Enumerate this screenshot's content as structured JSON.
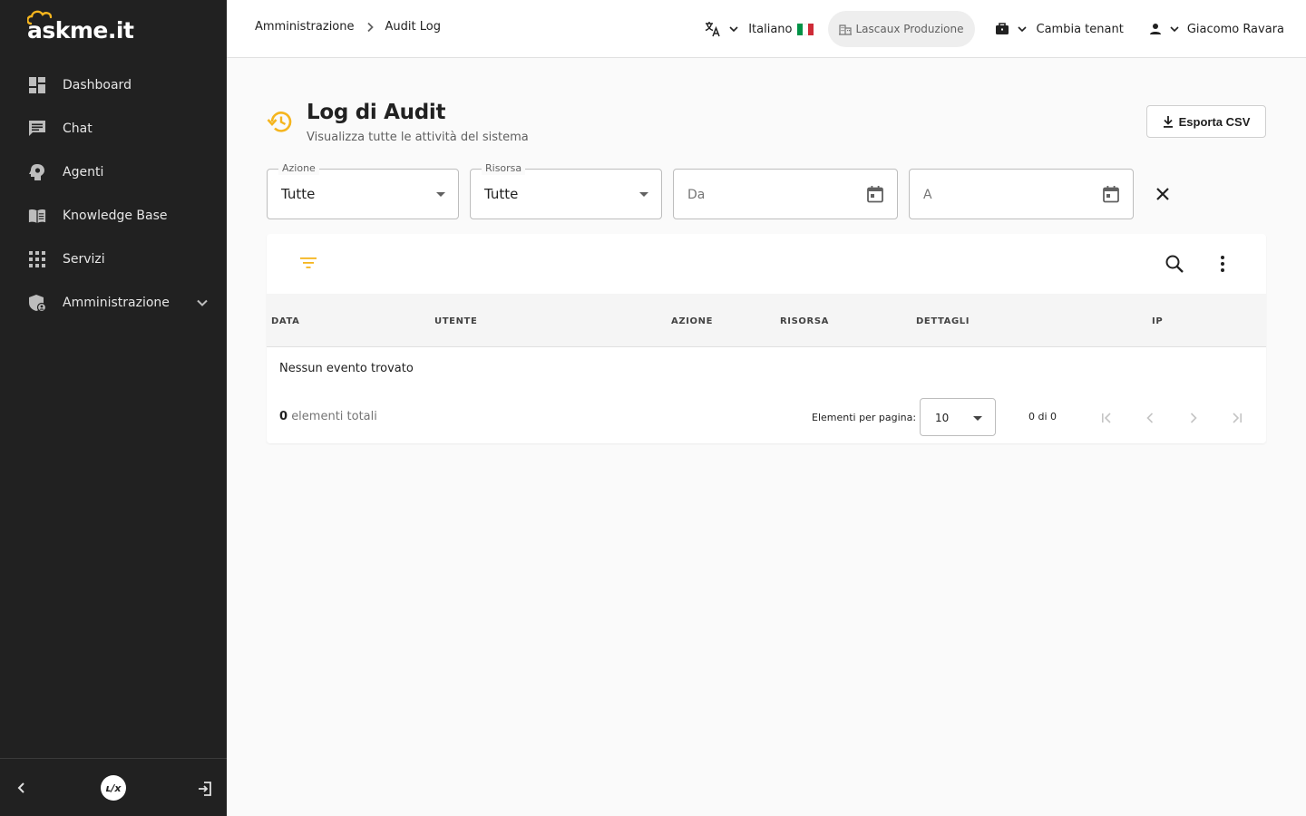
{
  "app": {
    "logo_text": "askme.it"
  },
  "sidebar": {
    "items": [
      {
        "label": "Dashboard",
        "icon": "dashboard-icon"
      },
      {
        "label": "Chat",
        "icon": "chat-icon"
      },
      {
        "label": "Agenti",
        "icon": "agent-icon"
      },
      {
        "label": "Knowledge Base",
        "icon": "book-icon"
      },
      {
        "label": "Servizi",
        "icon": "apps-grid-icon"
      },
      {
        "label": "Amministrazione",
        "icon": "admin-shield-icon"
      }
    ],
    "footer_brand": "ʟ/x"
  },
  "topbar": {
    "breadcrumb": [
      "Amministrazione",
      "Audit Log"
    ],
    "language": "Italiano",
    "tenant": "Lascaux Produzione",
    "switch_tenant": "Cambia tenant",
    "user": "Giacomo Ravara"
  },
  "page": {
    "title": "Log di Audit",
    "subtitle": "Visualizza tutte le attività del sistema",
    "export_label": "Esporta CSV"
  },
  "filters": {
    "action_label": "Azione",
    "action_value": "Tutte",
    "resource_label": "Risorsa",
    "resource_value": "Tutte",
    "from_placeholder": "Da",
    "to_placeholder": "A"
  },
  "table": {
    "columns": [
      "DATA",
      "UTENTE",
      "AZIONE",
      "RISORSA",
      "DETTAGLI",
      "IP"
    ],
    "empty_message": "Nessun evento trovato",
    "total_count": "0",
    "total_label": "elementi totali",
    "per_page_label": "Elementi per pagina:",
    "per_page_value": "10",
    "range_label": "0 di 0"
  },
  "colors": {
    "sidebar_bg": "#212121",
    "accent": "#f5b51e",
    "flag_green": "#009246",
    "flag_white": "#ffffff",
    "flag_red": "#ce2b37"
  }
}
